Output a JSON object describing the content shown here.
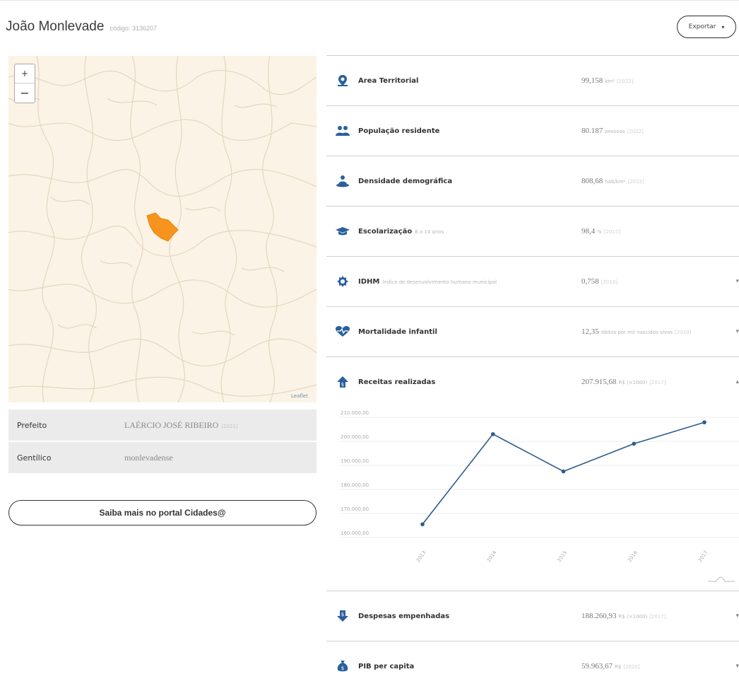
{
  "header": {
    "city": "João Monlevade",
    "code": "código: 3136207",
    "export_label": "Exportar",
    "export_caret": "▾"
  },
  "map": {
    "zoom_in": "+",
    "zoom_out": "−",
    "attribution": "Leaflet",
    "highlight_color": "#f7941d"
  },
  "info": [
    {
      "key": "Prefeito",
      "value": "LAÉRCIO JOSÉ RIBEIRO",
      "year": "[2021]"
    },
    {
      "key": "Gentílico",
      "value": "monlevadense",
      "year": ""
    }
  ],
  "portal_button": "Saiba mais no portal Cidades@",
  "indicators": [
    {
      "icon": "map-pin-icon",
      "label": "Área Territorial",
      "note": "",
      "value": "99,158",
      "unit": "km²",
      "year": "[2022]",
      "expand": false
    },
    {
      "icon": "people-icon",
      "label": "População residente",
      "note": "",
      "value": "80.187",
      "unit": "pessoas",
      "year": "[2022]",
      "expand": false
    },
    {
      "icon": "density-icon",
      "label": "Densidade demográfica",
      "note": "",
      "value": "808,68",
      "unit": "hab/km²",
      "year": "[2022]",
      "expand": false
    },
    {
      "icon": "graduation-cap-icon",
      "label": "Escolarização",
      "note": "6 a 14 anos",
      "value": "98,4",
      "unit": "%",
      "year": "[2010]",
      "expand": false
    },
    {
      "icon": "idhm-icon",
      "label": "IDHM",
      "note": "Índice de desenvolvimento humano municipal",
      "value": "0,758",
      "unit": "",
      "year": "[2010]",
      "expand": true
    },
    {
      "icon": "heartbeat-icon",
      "label": "Mortalidade infantil",
      "note": "",
      "value": "12,35",
      "unit": "óbitos por mil nascidos vivos",
      "year": "[2020]",
      "expand": true
    },
    {
      "icon": "revenue-icon",
      "label": "Receitas realizadas",
      "note": "",
      "value": "207.915,68",
      "unit": "R$ (×1000)",
      "year": "[2017]",
      "expand": true
    }
  ],
  "bottom_indicators": [
    {
      "icon": "expense-icon",
      "label": "Despesas empenhadas",
      "note": "",
      "value": "188.260,93",
      "unit": "R$ (×1000)",
      "year": "[2017]",
      "expand": true
    },
    {
      "icon": "money-bag-icon",
      "label": "PIB per capita",
      "note": "",
      "value": "59.963,67",
      "unit": "R$",
      "year": "[2020]",
      "expand": true
    }
  ],
  "colors": {
    "accent": "#2a5f9e",
    "line": "#2e5a8c"
  },
  "chart_data": {
    "type": "line",
    "categories": [
      "2013",
      "2014",
      "2015",
      "2016",
      "2017"
    ],
    "values": [
      165500,
      203000,
      187500,
      199000,
      207900
    ],
    "ylim": [
      160000,
      210000
    ],
    "yticks": [
      "160.000,00",
      "170.000,00",
      "180.000,00",
      "190.000,00",
      "200.000,00",
      "210.000,00"
    ],
    "grid": true
  }
}
